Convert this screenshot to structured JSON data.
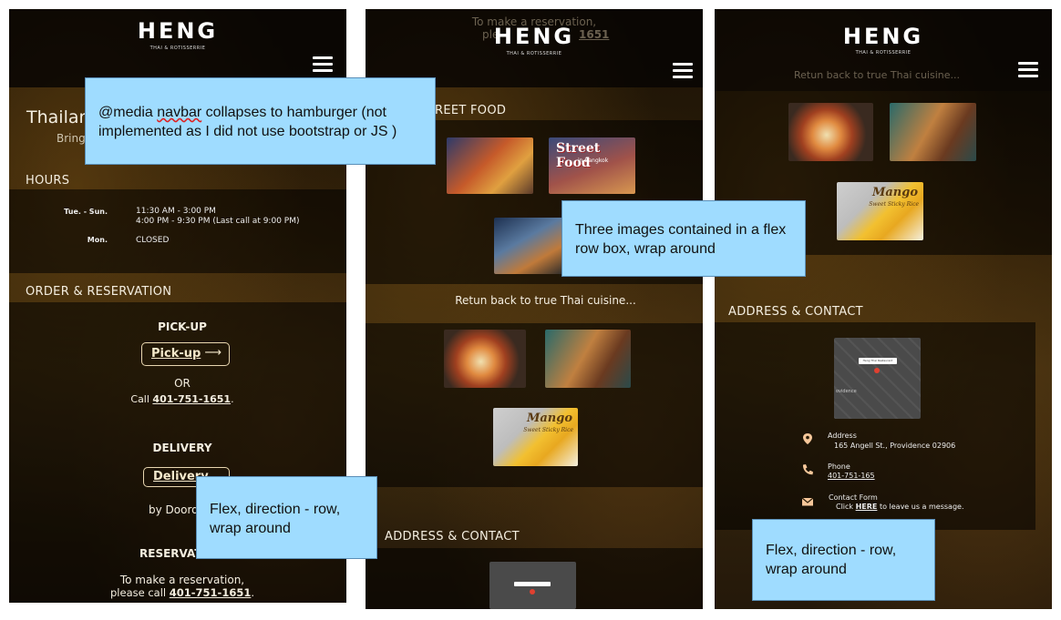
{
  "brand": {
    "name": "HENG",
    "tagline": "THAI & ROTISSERRIE"
  },
  "panel1": {
    "intro_title": "Thailan",
    "intro_sub": "Bring",
    "hours_title": "HOURS",
    "hours": [
      {
        "day": "Tue. - Sun.",
        "line1": "11:30 AM - 3:00 PM",
        "line2": "4:00 PM - 9:30 PM   (Last call at 9:00 PM)"
      },
      {
        "day": "Mon.",
        "line1": "CLOSED",
        "line2": ""
      }
    ],
    "order_title": "ORDER & RESERVATION",
    "pickup_heading": "PICK-UP",
    "pickup_button": "Pick-up",
    "or_text": "OR",
    "call_prefix": "Call ",
    "phone": "401-751-1651",
    "delivery_heading": "DELIVERY",
    "delivery_button": "Delivery",
    "by_text": "by Doord",
    "reservation_heading": "RESERVAT",
    "reservation_line1": "To make a reservation,",
    "reservation_line2_prefix": "please call ",
    "reservation_phone": "401-751-1651"
  },
  "panel2": {
    "top_line1": "To make a reservation,",
    "top_line2": "ple",
    "top_phone": "1651",
    "street_title": "REET FOOD",
    "street_food_label": "Street Food",
    "street_food_sub": "in Bangkok",
    "caption": "Retun back to true Thai cuisine...",
    "mango_label": "Mango",
    "mango_sub": "Sweet Sticky Rice",
    "address_title": "ADDRESS & CONTACT"
  },
  "panel3": {
    "caption": "Retun back to true Thai cuisine...",
    "mango_label": "Mango",
    "mango_sub": "Sweet Sticky Rice",
    "address_title": "ADDRESS & CONTACT",
    "map_label": "Heng Thai Restaurant",
    "map_area": "ovidence",
    "contacts": [
      {
        "icon": "location-pin-icon",
        "label": "Address",
        "value": "165 Angell St., Providence 02906"
      },
      {
        "icon": "phone-icon",
        "label": "Phone",
        "value": "401-751-165"
      },
      {
        "icon": "envelope-icon",
        "label": "Contact Form",
        "value_prefix": "Click ",
        "value_link": "HERE",
        "value_suffix": " to leave us a message."
      }
    ]
  },
  "callouts": {
    "navbar": {
      "prefix": "@media ",
      "wavy": "navbar",
      "rest": " collapses to hamburger (not implemented as I did not use bootstrap or JS )"
    },
    "images": "Three images contained in a flex row box, wrap around",
    "flex1": "Flex, direction - row, wrap around",
    "flex2": "Flex, direction - row, wrap around"
  },
  "colors": {
    "callout_bg": "#9fdcff",
    "callout_border": "#5a8fb8",
    "text_light": "#f4eee0",
    "button_border": "#e8d6b0"
  }
}
